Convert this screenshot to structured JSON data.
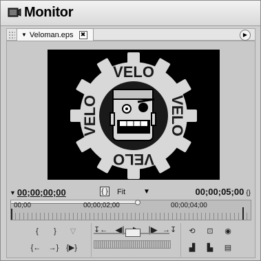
{
  "window": {
    "title": "Monitor"
  },
  "tab": {
    "label": "Veloman.eps",
    "close_glyph": "✖"
  },
  "timecode": {
    "current": "00;00;00;00",
    "duration": "00;00;05;00",
    "zoom": "Fit"
  },
  "ruler": {
    "labels": [
      "00;00",
      "00;00;02;00",
      "00;00;04;00"
    ]
  },
  "artwork": {
    "text_top": "VELO",
    "text_right": "VELO",
    "text_bottom": "VELO",
    "text_left": "VELO"
  },
  "icons": {
    "app": "monitor-app-icon",
    "menu": "panel-menu-icon",
    "tab_dd": "tab-dropdown-icon",
    "set_in": "set-in-point-icon",
    "set_out": "set-out-point-icon",
    "set_marker": "set-marker-icon",
    "goto_in": "go-to-in-point-icon",
    "goto_out": "go-to-out-point-icon",
    "play_in_out": "play-in-to-out-icon",
    "step_back": "step-back-icon",
    "play": "play-icon",
    "step_fwd": "step-forward-icon",
    "prev_edit": "previous-edit-icon",
    "next_edit": "next-edit-icon",
    "loop": "loop-icon",
    "safe_margins": "safe-margins-icon",
    "output": "output-icon",
    "insert": "insert-icon",
    "overlay": "overlay-icon",
    "export_frame": "export-frame-icon"
  },
  "colors": {
    "background": "#cfcfcf",
    "viewer": "#000000",
    "logo_light": "#d8d8d8",
    "logo_dark": "#1a1a1a"
  }
}
